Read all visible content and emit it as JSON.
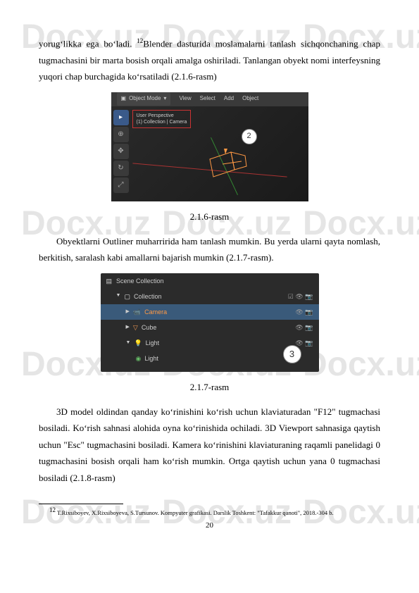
{
  "watermark": "Docx.uz",
  "para1_a": "yorugʻlikka ega boʻladi. ",
  "para1_sup": "12",
  "para1_b": "Blender dasturida moslamalarni tanlash sichqonchaning chap tugmachasini bir marta bosish orqali amalga oshiriladi. Tanlangan obyekt nomi interfeysning yuqori chap burchagida koʻrsatiladi (2.1.6-rasm)",
  "screenshot1": {
    "toolbar": {
      "object_mode": "Object Mode",
      "view": "View",
      "select": "Select",
      "add": "Add",
      "object": "Object"
    },
    "overlay": {
      "line1": "User Perspective",
      "line2": "(1) Collection | Camera"
    },
    "marker": "2"
  },
  "caption1": "2.1.6-rasm",
  "para2": "Obyektlarni Outliner muharririda ham tanlash mumkin. Bu yerda ularni qayta nomlash, berkitish, saralash kabi amallarni bajarish mumkin (2.1.7-rasm).",
  "screenshot2": {
    "header": "Scene Collection",
    "items": {
      "collection": "Collection",
      "camera": "Camera",
      "cube": "Cube",
      "light": "Light",
      "light_data": "Light"
    },
    "marker": "3"
  },
  "caption2": "2.1.7-rasm",
  "para3": "3D model oldindan qanday koʻrinishini koʻrish uchun klaviaturadan \"F12\" tugmachasi bosiladi. Koʻrish sahnasi alohida oyna koʻrinishida ochiladi. 3D Viewport sahnasiga qaytish uchun \"Esc\" tugmachasini bosiladi. Kamera koʻrinishini klaviaturaning raqamli panelidagi 0 tugmachasini bosish orqali ham koʻrish mumkin. Ortga qaytish uchun yana 0 tugmachasi bosiladi (2.1.8-rasm)",
  "footnote": {
    "num": "12",
    "text": " T.Rixsiboyev, X.Rixsiboyeva, S.Tursunov.  Kompyuter grafikasi. Darslik Toshkent: \"Tafakkur qanoti\",  2018.-304 b."
  },
  "page_num": "20"
}
